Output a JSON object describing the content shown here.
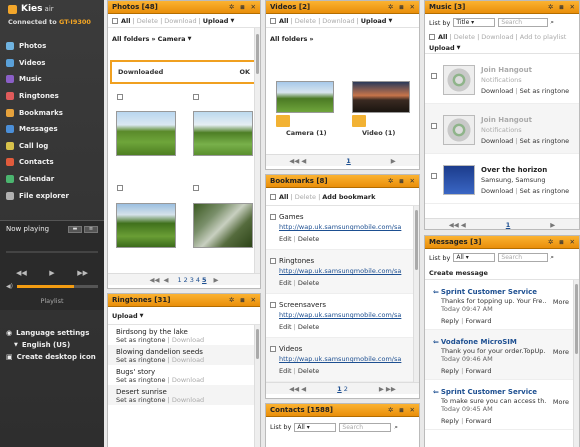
{
  "app": {
    "brand": "Kies",
    "brand_suffix": "air",
    "connected_prefix": "Connected to",
    "device": "GT-I9300"
  },
  "nav": [
    {
      "label": "Photos",
      "color": "#6fb3e0"
    },
    {
      "label": "Videos",
      "color": "#5aa0d8"
    },
    {
      "label": "Music",
      "color": "#8b5fc7"
    },
    {
      "label": "Ringtones",
      "color": "#e05b5b"
    },
    {
      "label": "Bookmarks",
      "color": "#e6a23c"
    },
    {
      "label": "Messages",
      "color": "#4b8fd8"
    },
    {
      "label": "Call log",
      "color": "#d8c24b"
    },
    {
      "label": "Contacts",
      "color": "#e15b3c"
    },
    {
      "label": "Calendar",
      "color": "#4bb56f"
    },
    {
      "label": "File explorer",
      "color": "#b0b0b0"
    }
  ],
  "now_playing": {
    "title": "Now playing",
    "playlist": "Playlist"
  },
  "sidebar_bottom": {
    "language_settings": "Language settings",
    "language": "English (US)",
    "create_icon": "Create desktop icon"
  },
  "photos": {
    "title": "Photos [48]",
    "all": "All",
    "delete": "Delete",
    "download": "Download",
    "upload": "Upload",
    "all_folders": "All folders",
    "camera": "Camera",
    "downloaded": "Downloaded",
    "ok": "OK",
    "pages": [
      "1",
      "2",
      "3",
      "4",
      "5"
    ],
    "current_page": "5"
  },
  "videos": {
    "title": "Videos [2]",
    "all": "All",
    "delete": "Delete",
    "download": "Download",
    "upload": "Upload",
    "all_folders": "All folders",
    "folders": [
      {
        "label": "Camera (1)"
      },
      {
        "label": "Video (1)"
      }
    ],
    "page": "1"
  },
  "music": {
    "title": "Music [3]",
    "list_by": "List by",
    "title_sort": "Title",
    "search": "Search",
    "all": "All",
    "delete": "Delete",
    "download": "Download",
    "add_to_playlist": "Add to playlist",
    "upload": "Upload",
    "tracks": [
      {
        "title": "Join Hangout",
        "artist": "Notifications",
        "download": "Download",
        "ringtone": "Set as ringtone"
      },
      {
        "title": "Join Hangout",
        "artist": "Notifications",
        "download": "Download",
        "ringtone": "Set as ringtone"
      },
      {
        "title": "Over the horizon",
        "artist": "Samsung, Samsung",
        "download": "Download",
        "ringtone": "Set as ringtone"
      }
    ],
    "page": "1"
  },
  "ringtones": {
    "title": "Ringtones [31]",
    "upload": "Upload",
    "items": [
      {
        "title": "Birdsong by the lake",
        "set": "Set as ringtone",
        "download": "Download"
      },
      {
        "title": "Blowing dandelion seeds",
        "set": "Set as ringtone",
        "download": "Download"
      },
      {
        "title": "Bugs' story",
        "set": "Set as ringtone",
        "download": "Download"
      },
      {
        "title": "Desert sunrise",
        "set": "Set as ringtone",
        "download": "Download"
      }
    ]
  },
  "bookmarks": {
    "title": "Bookmarks [8]",
    "all": "All",
    "delete": "Delete",
    "add": "Add bookmark",
    "items": [
      {
        "title": "Games",
        "url": "http://wap.uk.samsungmobile.com/sa",
        "edit": "Edit",
        "delete": "Delete"
      },
      {
        "title": "Ringtones",
        "url": "http://wap.uk.samsungmobile.com/sa",
        "edit": "Edit",
        "delete": "Delete"
      },
      {
        "title": "Screensavers",
        "url": "http://wap.uk.samsungmobile.com/sa",
        "edit": "Edit",
        "delete": "Delete"
      },
      {
        "title": "Videos",
        "url": "http://wap.uk.samsungmobile.com/sa",
        "edit": "Edit",
        "delete": "Delete"
      }
    ],
    "pages": [
      "1",
      "2"
    ],
    "current_page": "1"
  },
  "messages": {
    "title": "Messages [3]",
    "list_by": "List by",
    "all": "All",
    "search": "Search",
    "create": "Create message",
    "items": [
      {
        "from": "Sprint Customer Service",
        "text": "Thanks for topping up. Your Fre...",
        "time": "Today 09:47 AM",
        "more": "More",
        "reply": "Reply",
        "forward": "Forward"
      },
      {
        "from": "Vodafone MicroSIM",
        "text": "Thank you for your order.TopUp...",
        "time": "Today 09:46 AM",
        "more": "More",
        "reply": "Reply",
        "forward": "Forward"
      },
      {
        "from": "Sprint Customer Service",
        "text": "To make sure you can access th...",
        "time": "Today 09:45 AM",
        "more": "More",
        "reply": "Reply",
        "forward": "Forward"
      }
    ]
  },
  "contacts": {
    "title": "Contacts [1588]",
    "list_by": "List by",
    "all": "All",
    "search": "Search"
  }
}
